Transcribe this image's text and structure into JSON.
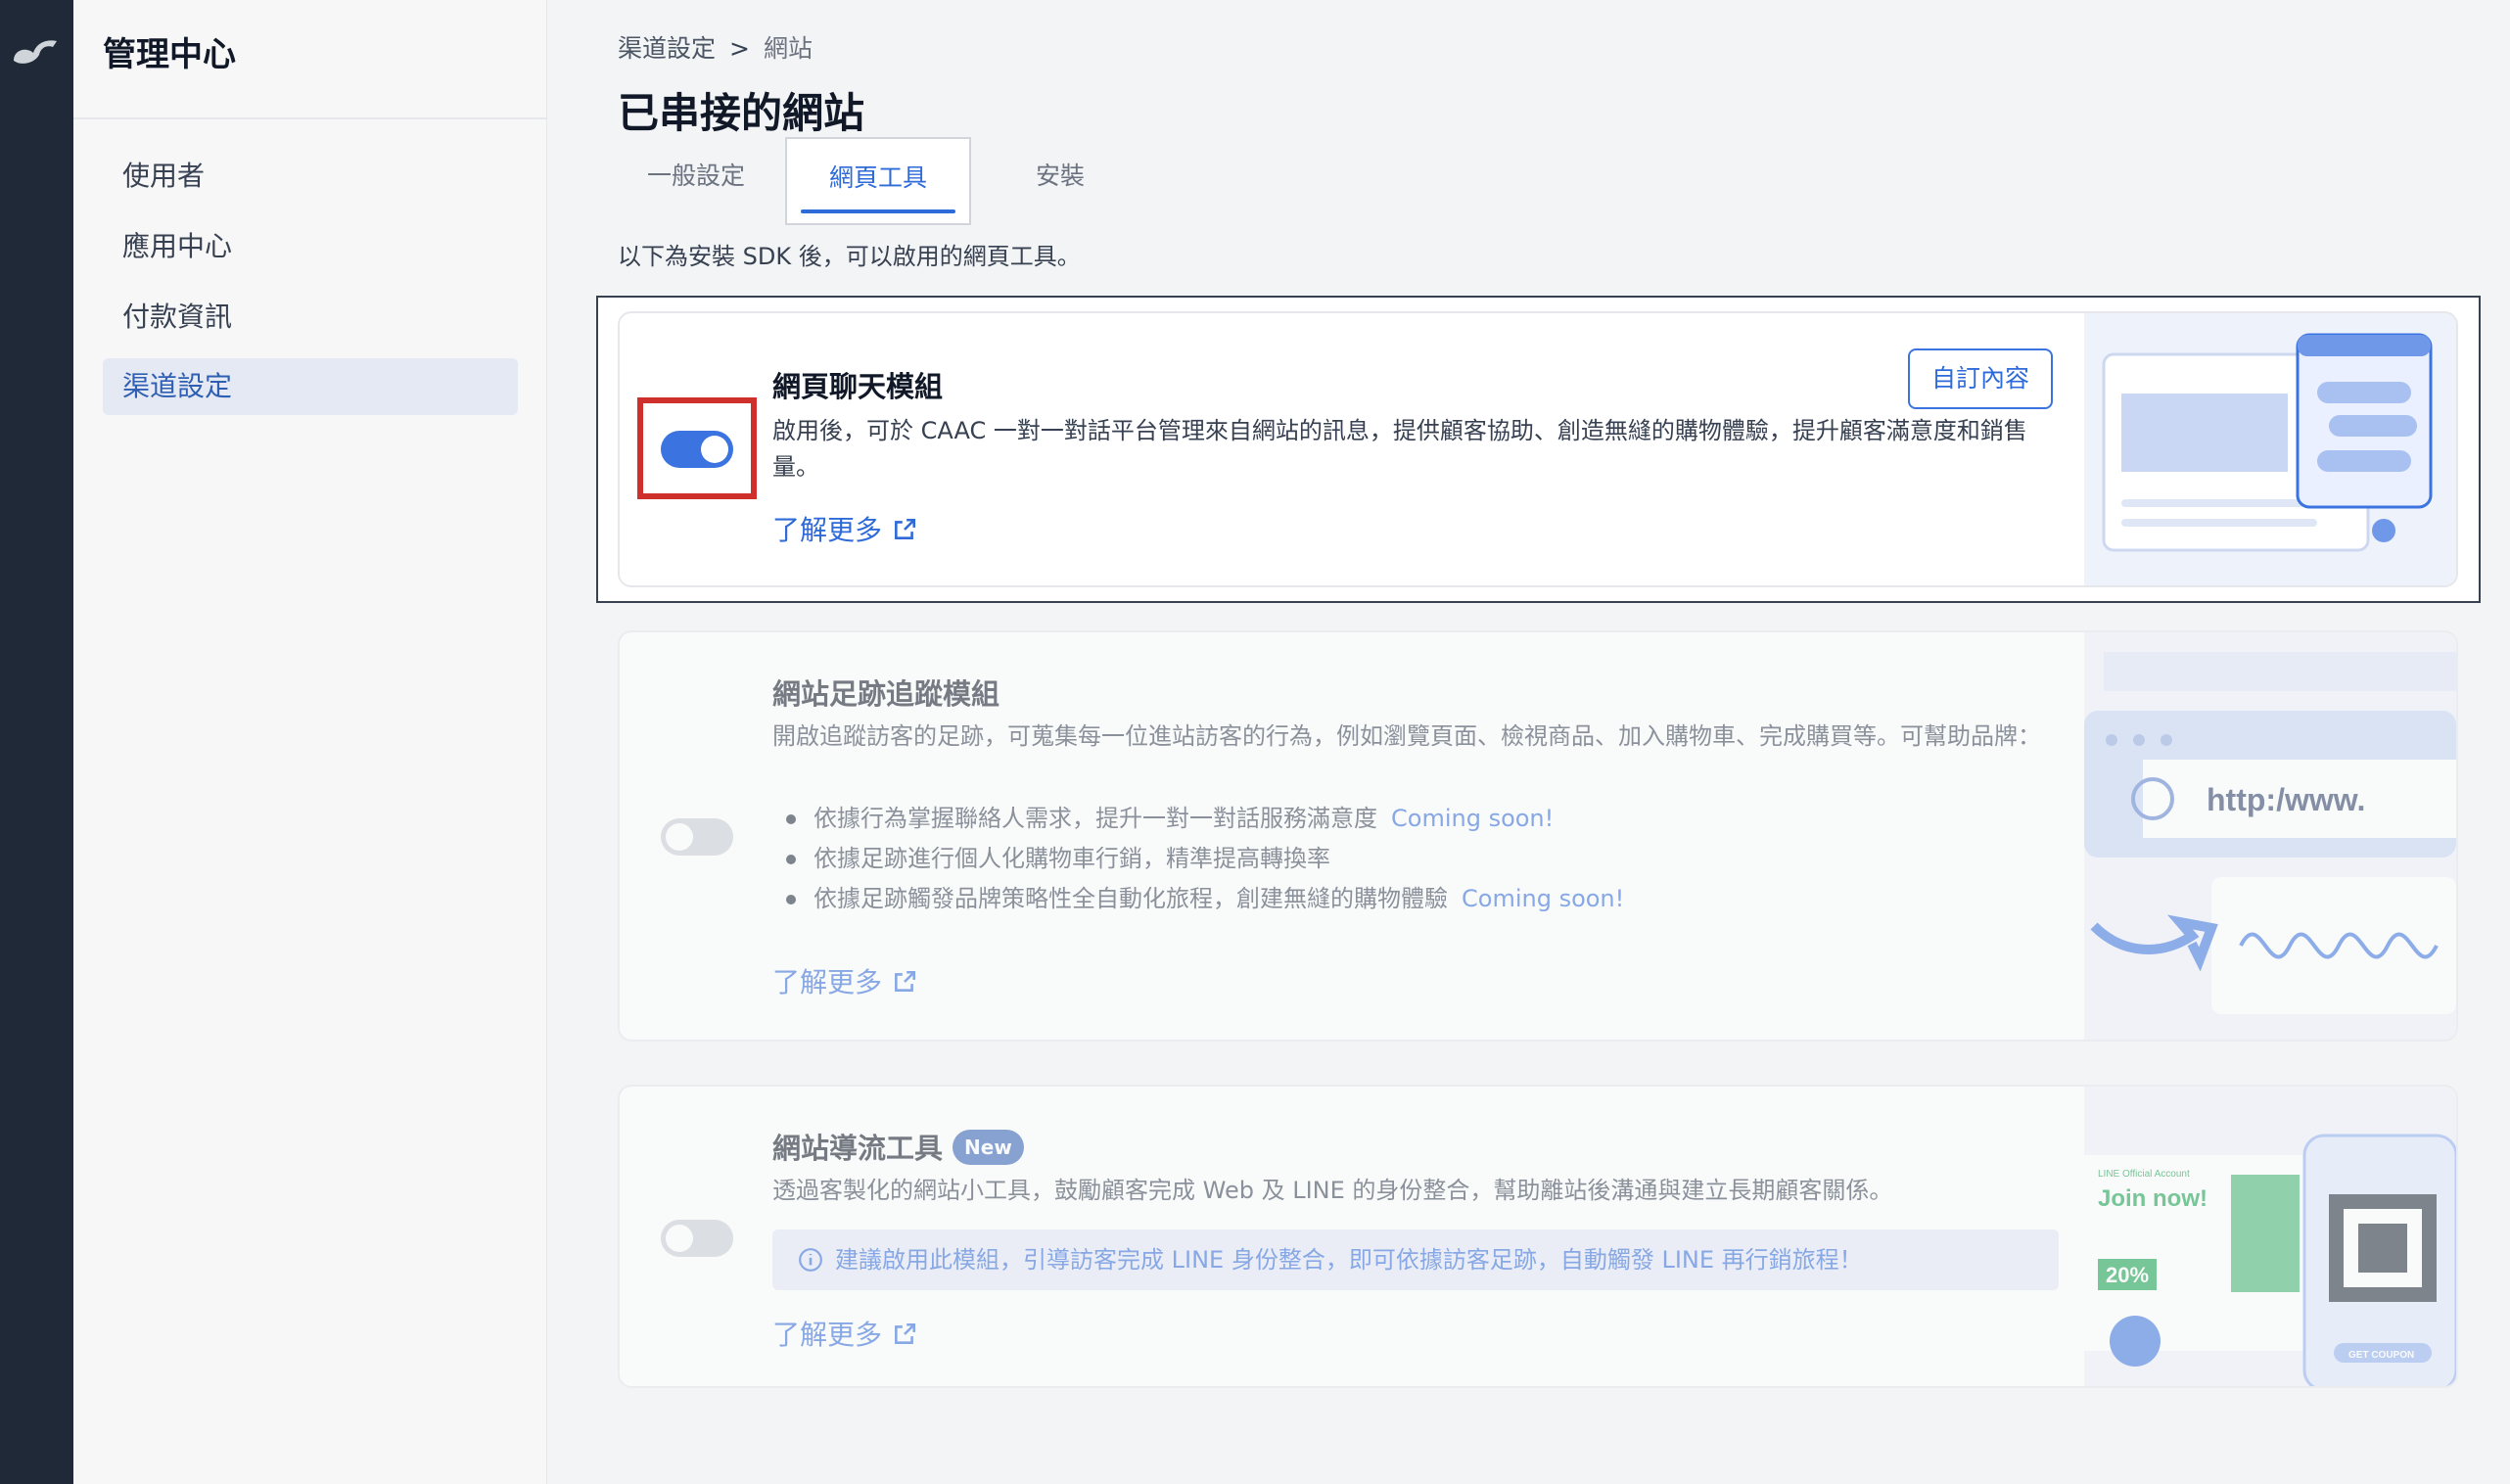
{
  "sidebar": {
    "title": "管理中心",
    "items": [
      {
        "label": "使用者"
      },
      {
        "label": "應用中心"
      },
      {
        "label": "付款資訊"
      },
      {
        "label": "渠道設定"
      }
    ]
  },
  "breadcrumb": {
    "parent": "渠道設定",
    "separator": ">",
    "current": "網站"
  },
  "page_title": "已串接的網站",
  "tabs": [
    {
      "label": "一般設定"
    },
    {
      "label": "網頁工具"
    },
    {
      "label": "安裝"
    }
  ],
  "intro": "以下為安裝 SDK 後，可以啟用的網頁工具。",
  "cards": [
    {
      "title": "網頁聊天模組",
      "enabled": true,
      "button_label": "自訂內容",
      "description": "啟用後，可於 CAAC 一對一對話平台管理來自網站的訊息，提供顧客協助、創造無縫的購物體驗，提升顧客滿意度和銷售量。",
      "learn_more": "了解更多"
    },
    {
      "title": "網站足跡追蹤模組",
      "enabled": false,
      "description": "開啟追蹤訪客的足跡，可蒐集每一位進站訪客的行為，例如瀏覽頁面、檢視商品、加入購物車、完成購買等。可幫助品牌：",
      "bullets": [
        {
          "text": "依據行為掌握聯絡人需求，提升一對一對話服務滿意度",
          "tag": "Coming soon!"
        },
        {
          "text": "依據足跡進行個人化購物車行銷，精準提高轉換率",
          "tag": ""
        },
        {
          "text": "依據足跡觸發品牌策略性全自動化旅程，創建無縫的購物體驗",
          "tag": "Coming soon!"
        }
      ],
      "illustration_text": "http:/www.",
      "learn_more": "了解更多"
    },
    {
      "title": "網站導流工具",
      "badge": "New",
      "enabled": false,
      "description": "透過客製化的網站小工具，鼓勵顧客完成 Web 及 LINE 的身份整合，幫助離站後溝通與建立長期顧客關係。",
      "info": "建議啟用此模組，引導訪客完成 LINE 身份整合，即可依據訪客足跡，自動觸發 LINE 再行銷旅程！",
      "illustration": {
        "account": "LINE Official Account",
        "join": "Join now!",
        "discount": "20%",
        "coupon": "GET COUPON"
      },
      "learn_more": "了解更多"
    }
  ],
  "colors": {
    "accent": "#2f6bd8",
    "highlight": "#d0302c",
    "rail": "#1f2937"
  }
}
